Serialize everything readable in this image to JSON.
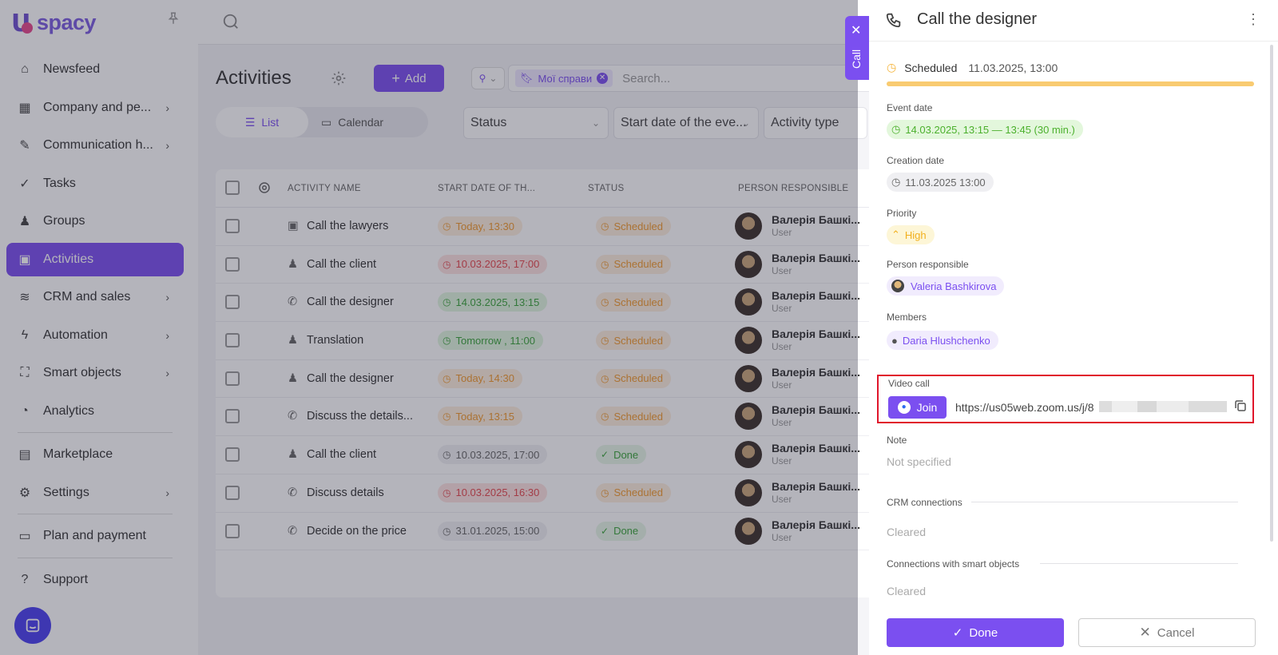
{
  "app": {
    "logo_text": "spacy"
  },
  "sidebar": {
    "items": [
      {
        "label": "Newsfeed",
        "icon": "home-icon",
        "chevron": false,
        "active": false
      },
      {
        "label": "Company and pe...",
        "icon": "building-icon",
        "chevron": true,
        "active": false
      },
      {
        "label": "Communication h...",
        "icon": "chat-icon",
        "chevron": true,
        "active": false
      },
      {
        "label": "Tasks",
        "icon": "check-circle-icon",
        "chevron": false,
        "active": false
      },
      {
        "label": "Groups",
        "icon": "users-icon",
        "chevron": false,
        "active": false
      },
      {
        "label": "Activities",
        "icon": "calendar-icon",
        "chevron": false,
        "active": true
      },
      {
        "label": "CRM and sales",
        "icon": "database-icon",
        "chevron": true,
        "active": false
      },
      {
        "label": "Automation",
        "icon": "lightning-icon",
        "chevron": true,
        "active": false
      },
      {
        "label": "Smart objects",
        "icon": "smart-object-icon",
        "chevron": true,
        "active": false
      },
      {
        "label": "Analytics",
        "icon": "chart-icon",
        "chevron": false,
        "active": false
      },
      {
        "label": "Marketplace",
        "icon": "store-icon",
        "chevron": false,
        "active": false
      },
      {
        "label": "Settings",
        "icon": "gear-icon",
        "chevron": true,
        "active": false
      },
      {
        "label": "Plan and payment",
        "icon": "wallet-icon",
        "chevron": false,
        "active": false
      },
      {
        "label": "Support",
        "icon": "help-icon",
        "chevron": false,
        "active": false
      }
    ]
  },
  "page": {
    "title": "Activities",
    "add_label": "Add",
    "filter_chip": "Мої справи",
    "search_placeholder": "Search...",
    "view_list": "List",
    "view_calendar": "Calendar",
    "filters": [
      "Status",
      "Start date of the eve...",
      "Activity type"
    ]
  },
  "table": {
    "headers": [
      "ACTIVITY NAME",
      "START DATE OF TH...",
      "STATUS",
      "PERSON RESPONSIBLE"
    ],
    "rows": [
      {
        "icon": "calendar-icon",
        "name": "Call the lawyers",
        "start": "Today, 13:30",
        "start_color": "orange",
        "status": "Scheduled",
        "person": "Валерія Башкі...",
        "role": "User"
      },
      {
        "icon": "users-icon",
        "name": "Call the client",
        "start": "10.03.2025, 17:00",
        "start_color": "red",
        "status": "Scheduled",
        "person": "Валерія Башкі...",
        "role": "User"
      },
      {
        "icon": "phone-icon",
        "name": "Call the designer",
        "start": "14.03.2025, 13:15",
        "start_color": "green",
        "status": "Scheduled",
        "person": "Валерія Башкі...",
        "role": "User"
      },
      {
        "icon": "users-icon",
        "name": "Translation",
        "start": "Tomorrow , 11:00",
        "start_color": "green",
        "status": "Scheduled",
        "person": "Валерія Башкі...",
        "role": "User"
      },
      {
        "icon": "users-icon",
        "name": "Call the designer",
        "start": "Today, 14:30",
        "start_color": "orange",
        "status": "Scheduled",
        "person": "Валерія Башкі...",
        "role": "User"
      },
      {
        "icon": "phone-icon",
        "name": "Discuss the details...",
        "start": "Today, 13:15",
        "start_color": "orange",
        "status": "Scheduled",
        "person": "Валерія Башкі...",
        "role": "User"
      },
      {
        "icon": "users-icon",
        "name": "Call the client",
        "start": "10.03.2025, 17:00",
        "start_color": "grey",
        "status": "Done",
        "person": "Валерія Башкі...",
        "role": "User"
      },
      {
        "icon": "phone-icon",
        "name": "Discuss details",
        "start": "10.03.2025, 16:30",
        "start_color": "red",
        "status": "Scheduled",
        "person": "Валерія Башкі...",
        "role": "User"
      },
      {
        "icon": "phone-icon",
        "name": "Decide on the price",
        "start": "31.01.2025, 15:00",
        "start_color": "grey",
        "status": "Done",
        "person": "Валерія Башкі...",
        "role": "User"
      }
    ]
  },
  "call_tab": {
    "label": "Call"
  },
  "drawer": {
    "title": "Call the designer",
    "status": "Scheduled",
    "status_date": "11.03.2025, 13:00",
    "progress": 1.0,
    "event_date_label": "Event date",
    "event_date": "14.03.2025, 13:15 — 13:45 (30 min.)",
    "creation_date_label": "Creation date",
    "creation_date": "11.03.2025 13:00",
    "priority_label": "Priority",
    "priority": "High",
    "responsible_label": "Person responsible",
    "responsible": "Valeria Bashkirova",
    "members_label": "Members",
    "member": "Daria Hlushchenko",
    "video_label": "Video call",
    "join_label": "Join",
    "video_url": "https://us05web.zoom.us/j/8",
    "note_label": "Note",
    "note_value": "Not specified",
    "crm_label": "CRM connections",
    "crm_value": "Cleared",
    "smart_label": "Connections with smart objects",
    "smart_value": "Cleared",
    "done_label": "Done",
    "cancel_label": "Cancel"
  }
}
